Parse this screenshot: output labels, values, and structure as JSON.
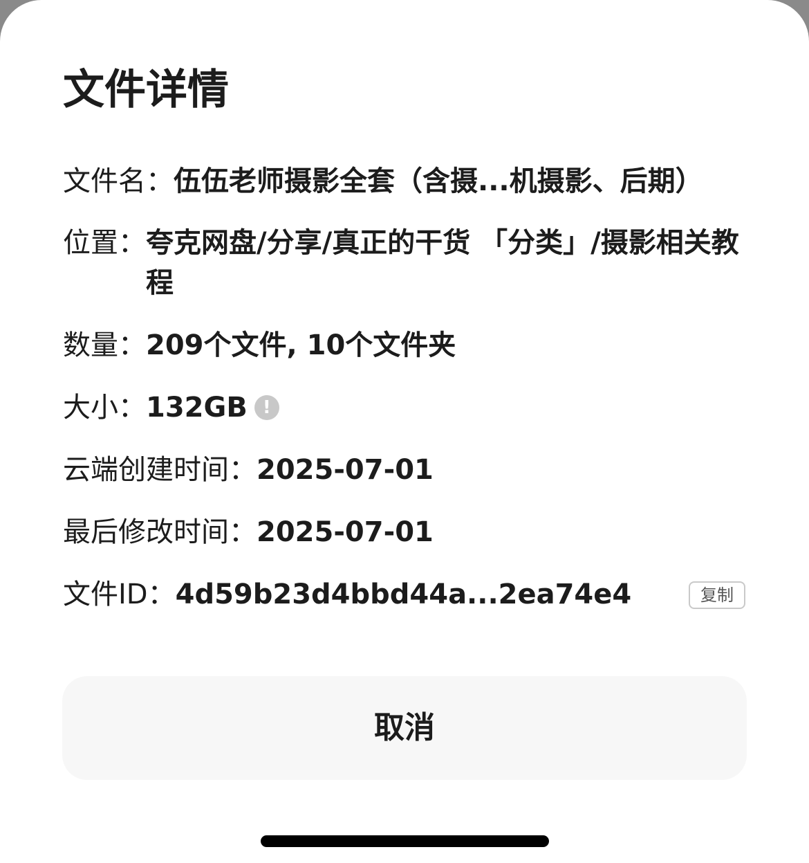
{
  "dialog": {
    "title": "文件详情",
    "file_name": {
      "label": "文件名：",
      "value": "伍伍老师摄影全套（含摄...机摄影、后期）"
    },
    "location": {
      "label": "位置：",
      "value": "夸克网盘/分享/真正的干货 「分类」/摄影相关教程"
    },
    "count": {
      "label": "数量：",
      "value": "209个文件, 10个文件夹"
    },
    "size": {
      "label": "大小：",
      "value": "132GB",
      "info_icon": "info-icon"
    },
    "created": {
      "label": "云端创建时间：",
      "value": "2025-07-01"
    },
    "modified": {
      "label": "最后修改时间：",
      "value": "2025-07-01"
    },
    "file_id": {
      "label": "文件ID：",
      "value": "4d59b23d4bbd44a...2ea74e4"
    },
    "copy_label": "复制",
    "cancel_label": "取消"
  }
}
